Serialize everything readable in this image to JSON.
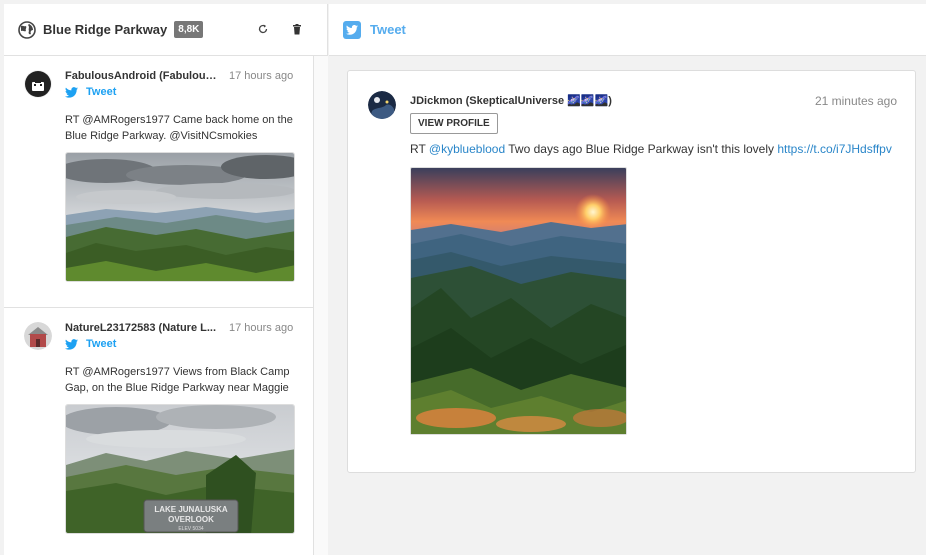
{
  "column": {
    "title": "Blue Ridge Parkway",
    "badge": "8,8K"
  },
  "feed": [
    {
      "author": "FabulousAndroid (Fabulous...",
      "time": "17 hours ago",
      "type": "Tweet",
      "text": "RT @AMRogers1977 Came back home on the Blue Ridge Parkway. @VisitNCsmokies"
    },
    {
      "author": "NatureL23172583 (Nature L...",
      "time": "17 hours ago",
      "type": "Tweet",
      "text": "RT @AMRogers1977 Views from Black Camp Gap, on the Blue Ridge Parkway near Maggie",
      "sign_line1": "LAKE JUNALUSKA",
      "sign_line2": "OVERLOOK",
      "sign_line3": "ELEV 5034"
    }
  ],
  "panel": {
    "header_label": "Tweet",
    "author": "JDickmon (SkepticalUniverse 🌌🌌🌌)",
    "time": "21 minutes ago",
    "profile_button": "VIEW PROFILE",
    "text_prefix": "RT ",
    "mention": "@kyblueblood",
    "text_body": " Two days ago Blue Ridge Parkway isn't this lovely ",
    "link": "https://t.co/i7JHdsffpv"
  },
  "colors": {
    "twitter_blue": "#55acee",
    "link_blue": "#2a86c9",
    "badge_gray": "#777777"
  }
}
